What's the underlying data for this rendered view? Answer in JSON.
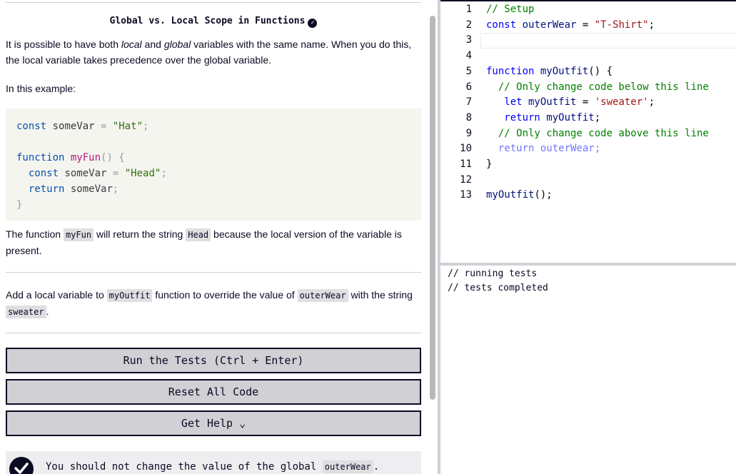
{
  "challenge": {
    "title": "Global vs. Local Scope in Functions",
    "intro": {
      "t1": "It is possible to have both ",
      "local": "local",
      "t2": " and ",
      "global": "global",
      "t3": " variables with the same name. When you do this, the local variable takes precedence over the global variable."
    },
    "example_label": "In this example:",
    "example_code": {
      "l1_kw": "const",
      "l1_id": " someVar ",
      "l1_eq": "=",
      "l1_str": " \"Hat\"",
      "l1_end": ";",
      "l3_kw": "function",
      "l3_fn": " myFun",
      "l3_end": "() {",
      "l4_kw": "  const",
      "l4_id": " someVar ",
      "l4_eq": "=",
      "l4_str": " \"Head\"",
      "l4_end": ";",
      "l5_kw": "  return",
      "l5_id": " someVar",
      "l5_end": ";",
      "l6": "}"
    },
    "explain": {
      "t1": "The function ",
      "c1": "myFun",
      "t2": " will return the string ",
      "c2": "Head",
      "t3": " because the local version of the variable is present."
    },
    "task": {
      "t1": "Add a local variable to ",
      "c1": "myOutfit",
      "t2": " function to override the value of ",
      "c2": "outerWear",
      "t3": " with the string ",
      "c3": "sweater",
      "t4": "."
    }
  },
  "buttons": {
    "run": "Run the Tests (Ctrl + Enter)",
    "reset": "Reset All Code",
    "help": "Get Help ⌄"
  },
  "tests": [
    {
      "text": "You should not change the value of the global ",
      "code": "outerWear",
      "end": "."
    }
  ],
  "editor": {
    "line_numbers": [
      "1",
      "2",
      "3",
      "4",
      "5",
      "6",
      "7",
      "8",
      "9",
      "10",
      "11",
      "12",
      "13"
    ],
    "lines": {
      "l1": "// Setup",
      "l2_kw": "const",
      "l2_id": " outerWear ",
      "l2_eq": "= ",
      "l2_str": "\"T-Shirt\"",
      "l2_end": ";",
      "l5_kw": "function",
      "l5_fn": " myOutfit",
      "l5_end": "() {",
      "l6": "  // Only change code below this line",
      "l7_kw": "   let",
      "l7_id": " myOutfit ",
      "l7_eq": "= ",
      "l7_str": "'sweater'",
      "l7_end": ";",
      "l8_kw": "   return",
      "l8_id": " myOutfit",
      "l8_end": ";",
      "l9": "  // Only change code above this line",
      "l10": "  return outerWear;",
      "l11": "}",
      "l13_fn": "myOutfit",
      "l13_end": "();"
    }
  },
  "console": {
    "lines": [
      "// running tests",
      "// tests completed"
    ]
  }
}
